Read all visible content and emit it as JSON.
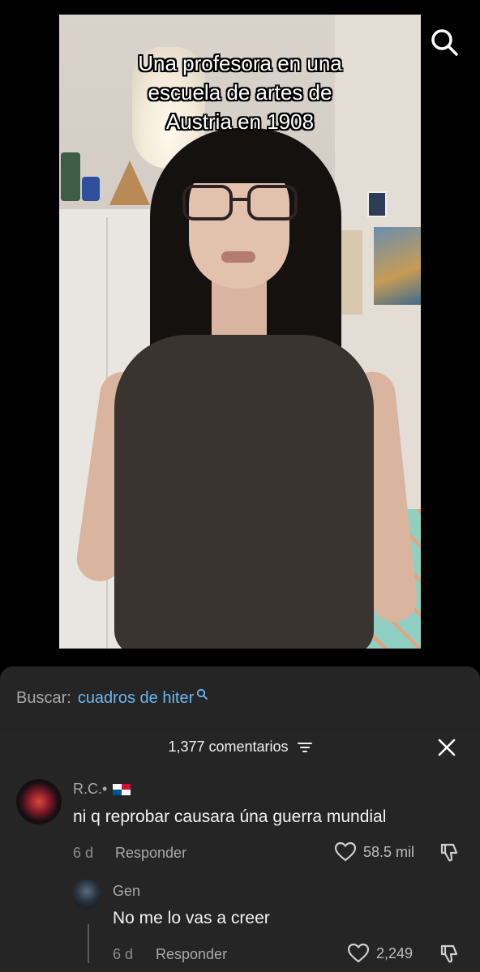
{
  "video": {
    "caption_lines": [
      "Una profesora en una",
      "escuela de artes de",
      "Austria en 1908"
    ]
  },
  "top_bar": {
    "search_icon": "search-icon"
  },
  "search": {
    "label": "Buscar:",
    "term": "cuadros de hiter"
  },
  "comments_header": {
    "count_label": "1,377 comentarios",
    "filter_icon": "filter-icon",
    "close_icon": "close-icon"
  },
  "comments": [
    {
      "username": "R.C.",
      "separator": "•",
      "flag": "panama-flag",
      "text": "ni q reprobar causara úna guerra mundial",
      "time": "6 d",
      "reply_label": "Responder",
      "likes": "58.5 mil"
    },
    {
      "username": "Gen",
      "text": "No me lo vas a creer",
      "time": "6 d",
      "reply_label": "Responder",
      "likes": "2,249"
    }
  ],
  "colors": {
    "sheet_bg": "#252525",
    "search_term": "#6cb6f2",
    "muted_text": "#a9a9a9"
  }
}
